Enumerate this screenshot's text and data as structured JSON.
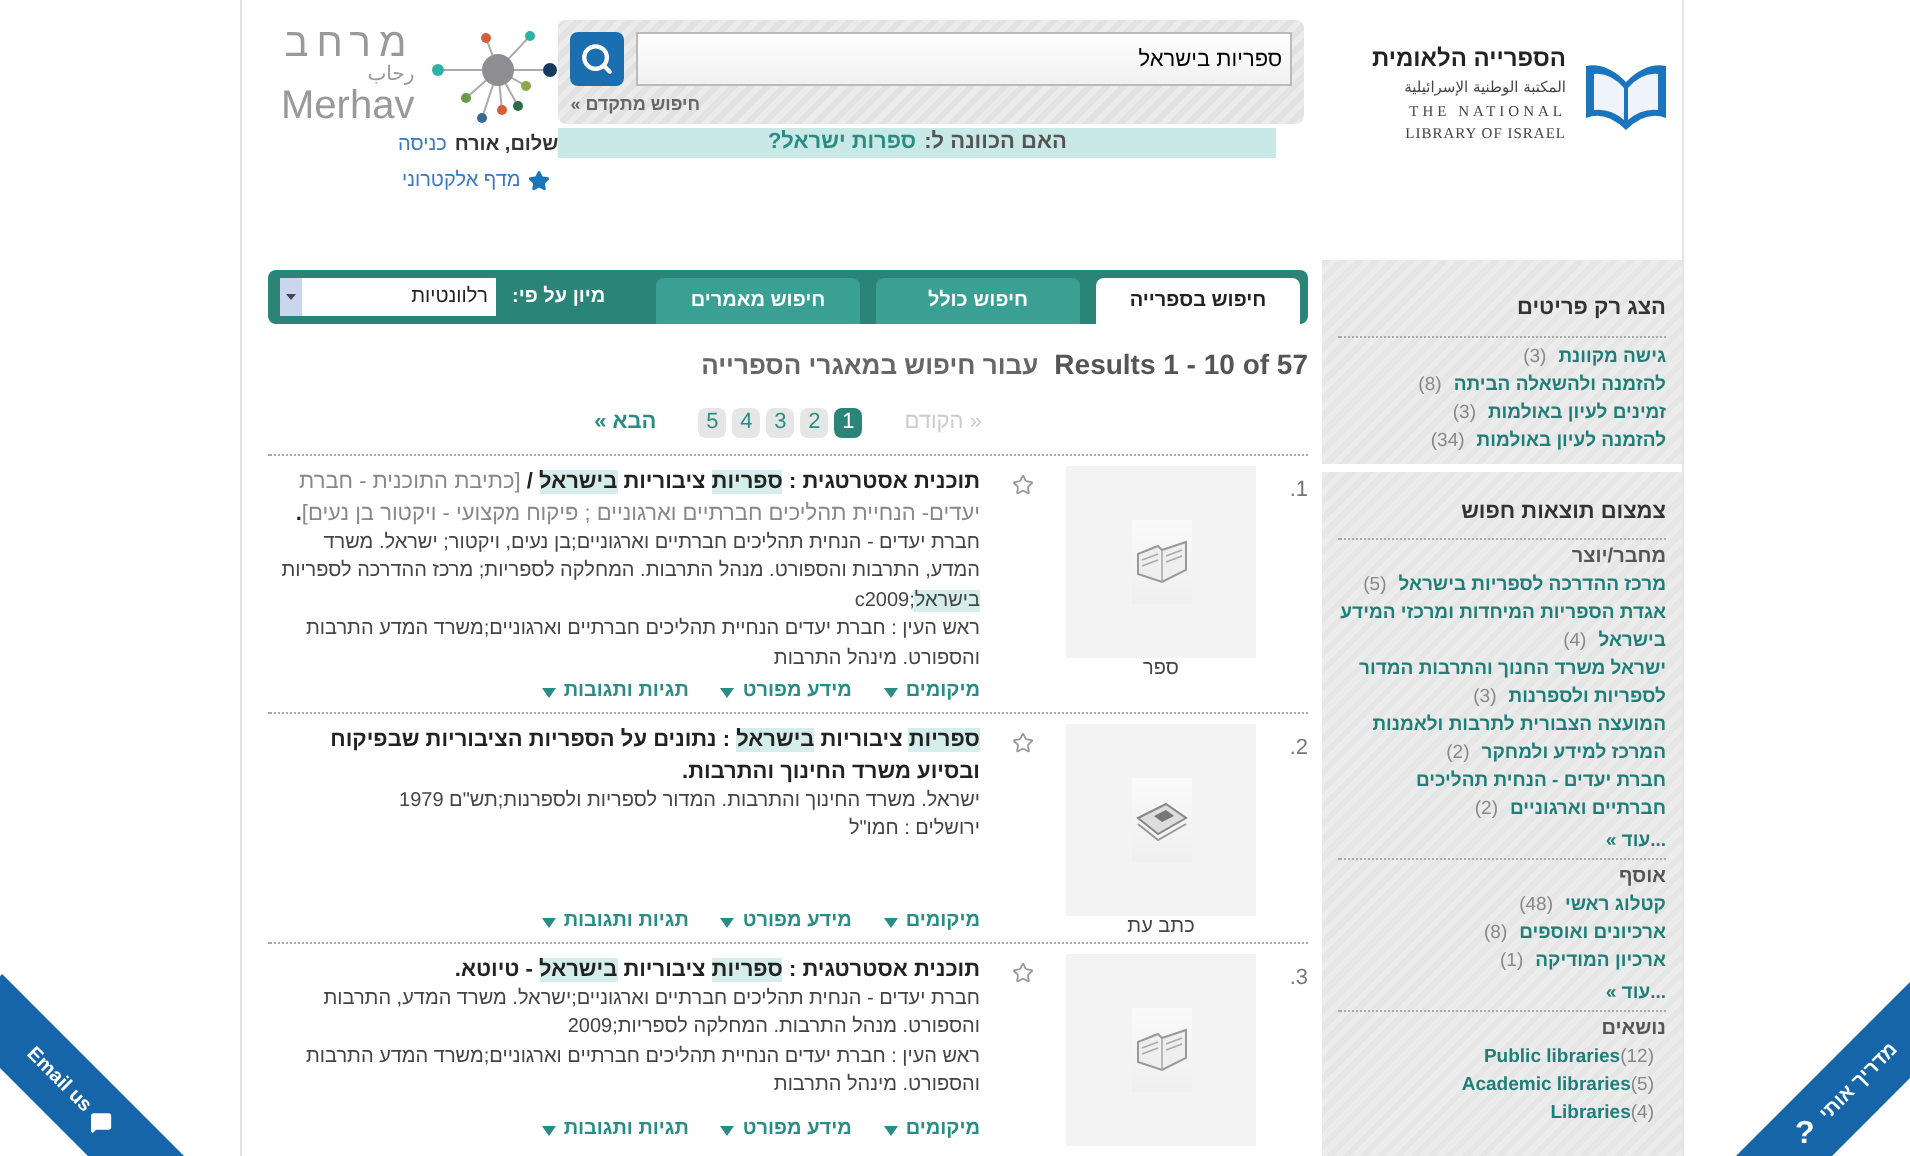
{
  "logo": {
    "hebrew": "הספרייה הלאומית",
    "arabic": "المكتبة الوطنية الإسرائيلية",
    "english_line_1": "THE NATIONAL",
    "english_line_2": "LIBRARY OF ISRAEL"
  },
  "search": {
    "value": "ספריות בישראל",
    "advanced_link": "חיפוש מתקדם »",
    "suggestion_prefix": "האם הכוונה ל:",
    "suggestion": "ספרות ישראל?"
  },
  "partner_logo": {
    "hebrew": "מרחב",
    "arabic": "رحاب",
    "latin": "Merhav"
  },
  "user": {
    "greeting": "שלום, אורח",
    "login_link": "כניסה",
    "shelf_link": "מדף אלקטרוני"
  },
  "tabs": [
    {
      "label": "חיפוש בספרייה",
      "selected": true
    },
    {
      "label": "חיפוש כולל",
      "selected": false
    },
    {
      "label": "חיפוש מאמרים",
      "selected": false
    }
  ],
  "sort": {
    "label": "מיון על פי:",
    "value": "רלוונטיות"
  },
  "results_header": {
    "count": "Results 1 - 10 of 57",
    "scope": "עבור חיפוש במאגרי הספרייה"
  },
  "pager": {
    "prev": {
      "label": "« הקודם",
      "disabled": true
    },
    "pages": [
      {
        "label": "1",
        "selected": true
      },
      {
        "label": "2",
        "selected": false
      },
      {
        "label": "3",
        "selected": false
      },
      {
        "label": "4",
        "selected": false
      },
      {
        "label": "5",
        "selected": false
      }
    ],
    "next": {
      "label": "הבא »",
      "disabled": false
    }
  },
  "results": [
    {
      "number": "1.",
      "kind": "book",
      "type_label": "ספר",
      "title": [
        {
          "text": "תוכנית אסטרטגית : ",
          "kind": "plain"
        },
        {
          "text": "ספריות",
          "kind": "match"
        },
        {
          "text": " ציבוריות ",
          "kind": "plain"
        },
        {
          "text": "בישראל",
          "kind": "match"
        },
        {
          "text": " / ",
          "kind": "plain"
        },
        {
          "text": "[כתיבת התוכנית - חברת יעדים- הנחיית תהליכים חברתיים וארגוניים ; פיקוח מקצועי - ויקטור בן נעים]",
          "kind": "note"
        },
        {
          "text": ".",
          "kind": "plain"
        }
      ],
      "lines": [
        [
          {
            "text": "חברת יעדים - הנחית תהליכים חברתיים וארגוניים;בן נעים, ויקטור; ישראל. משרד המדע, התרבות והספורט. מנהל התרבות. המחלקה לספריות; מרכז ההדרכה לספריות ",
            "kind": "plain"
          },
          {
            "text": "בישראל",
            "kind": "match"
          },
          {
            "text": ";c2009",
            "kind": "plain"
          }
        ],
        [
          {
            "text": "ראש העין : חברת יעדים הנחיית תהליכים חברתיים וארגוניים;משרד המדע התרבות והספורט. מינהל התרבות",
            "kind": "plain"
          }
        ]
      ],
      "actions": [
        "מיקומים",
        "מידע מפורט",
        "תגיות ותגובות"
      ]
    },
    {
      "number": "2.",
      "kind": "journal",
      "type_label": "כתב עת",
      "title": [
        {
          "text": "ספריות",
          "kind": "match"
        },
        {
          "text": " ציבוריות ",
          "kind": "plain"
        },
        {
          "text": "בישראל",
          "kind": "match"
        },
        {
          "text": " : נתונים על הספריות הציבוריות שבפיקוח ובסיוע משרד החינוך והתרבות.",
          "kind": "plain"
        }
      ],
      "lines": [
        [
          {
            "text": "ישראל. משרד החינוך והתרבות. המדור לספריות ולספרנות;תש\"ם 1979",
            "kind": "plain"
          }
        ],
        [
          {
            "text": "ירושלים : חמו\"ל",
            "kind": "plain"
          }
        ]
      ],
      "actions": [
        "מיקומים",
        "מידע מפורט",
        "תגיות ותגובות"
      ]
    },
    {
      "number": "3.",
      "kind": "book",
      "title": [
        {
          "text": "תוכנית אסטרטגית : ",
          "kind": "plain"
        },
        {
          "text": "ספריות",
          "kind": "match"
        },
        {
          "text": " ציבוריות ",
          "kind": "plain"
        },
        {
          "text": "בישראל",
          "kind": "match"
        },
        {
          "text": " - טיוטא.",
          "kind": "plain"
        }
      ],
      "lines": [
        [
          {
            "text": "חברת יעדים - הנחית תהליכים חברתיים וארגוניים;ישראל. משרד המדע, התרבות והספורט. מנהל התרבות. המחלקה לספריות;2009",
            "kind": "plain"
          }
        ],
        [
          {
            "text": "ראש העין : חברת יעדים הנחיית תהליכים חברתיים וארגוניים;משרד המדע התרבות והספורט. מינהל התרבות",
            "kind": "plain"
          }
        ]
      ],
      "actions": [
        "מיקומים",
        "מידע מפורט",
        "תגיות ותגובות"
      ]
    }
  ],
  "sidebar": {
    "show_only": {
      "heading": "הצג רק פריטים",
      "items": [
        {
          "label": "גישה מקוונת",
          "count": "(3)"
        },
        {
          "label": "להזמנה ולהשאלה הביתה",
          "count": "(8)"
        },
        {
          "label": "זמינים לעיון באולמות",
          "count": "(3)"
        },
        {
          "label": "להזמנה לעיון באולמות",
          "count": "(34)"
        }
      ]
    },
    "refine": {
      "heading": "צמצום תוצאות חפוש",
      "groups": [
        {
          "heading": "מחבר/יוצר",
          "items": [
            {
              "label": "מרכז ההדרכה לספריות בישראל",
              "count": "(5)"
            },
            {
              "label": "אגדת הספריות המיחדות ומרכזי המידע בישראל",
              "count": "(4)"
            },
            {
              "label": "ישראל משרד החנוך והתרבות המדור לספריות ולספרנות",
              "count": "(3)"
            },
            {
              "label": "המועצה הצבורית לתרבות ולאמנות המרכז למידע ולמחקר",
              "count": "(2)"
            },
            {
              "label": "חברת יעדים - הנחית תהליכים חברתיים וארגוניים",
              "count": "(2)"
            }
          ],
          "more": "...עוד »"
        },
        {
          "heading": "אוסף",
          "items": [
            {
              "label": "קטלוג ראשי",
              "count": "(48)"
            },
            {
              "label": "ארכיונים ואוספים",
              "count": "(8)"
            },
            {
              "label": "ארכיון המודיקה",
              "count": "(1)"
            }
          ],
          "more": "...עוד »"
        },
        {
          "heading": "נושאים",
          "items": [
            {
              "label": "Public libraries",
              "count": "(12)"
            },
            {
              "label": "Academic libraries",
              "count": "(5)"
            },
            {
              "label": "Libraries",
              "count": "(4)"
            }
          ]
        }
      ]
    }
  },
  "corner_links": {
    "email": "Email us",
    "guide": "מדריך אותי",
    "guide_mark": "?"
  }
}
